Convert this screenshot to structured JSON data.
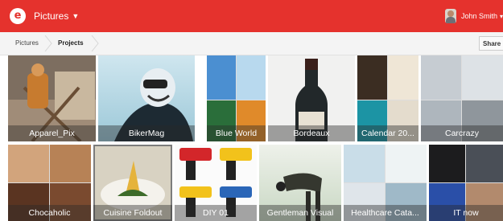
{
  "colors": {
    "accent": "#e5322d",
    "caption_overlay": "rgba(40,40,40,0.42)"
  },
  "header": {
    "logo_icon": "brand-logo-icon",
    "app_menu_label": "Pictures",
    "app_menu_icon": "chevron-down-icon",
    "user_name": "John Smith"
  },
  "breadcrumb": {
    "items": [
      "Pictures",
      "Projects"
    ],
    "separator_icon": "chevron-right-icon"
  },
  "toolbar": {
    "share_label": "Share"
  },
  "projects": [
    {
      "title": "Apparel_Pix"
    },
    {
      "title": "BikerMag"
    },
    {
      "title": "Blue World"
    },
    {
      "title": "Bordeaux"
    },
    {
      "title": "Calendar 20..."
    },
    {
      "title": "Carcrazy"
    },
    {
      "title": "Chocaholic"
    },
    {
      "title": "Cuisine Foldout",
      "selected": true
    },
    {
      "title": "DIY 01"
    },
    {
      "title": "Gentleman Visual"
    },
    {
      "title": "Healthcare Cata..."
    },
    {
      "title": "IT now"
    }
  ]
}
